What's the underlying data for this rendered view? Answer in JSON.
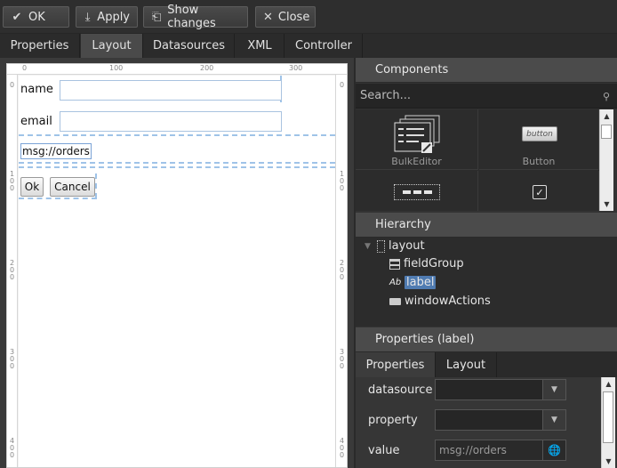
{
  "toolbar": {
    "ok_label": "OK",
    "apply_label": "Apply",
    "show_changes_label": "Show changes",
    "close_label": "Close"
  },
  "tabs": [
    {
      "label": "Properties"
    },
    {
      "label": "Layout"
    },
    {
      "label": "Datasources"
    },
    {
      "label": "XML"
    },
    {
      "label": "Controller"
    }
  ],
  "active_tab": "Layout",
  "canvas": {
    "ruler_top_ticks": [
      "0",
      "100",
      "200",
      "300"
    ],
    "ruler_left_ticks": [
      "0",
      "100",
      "200",
      "300",
      "400"
    ],
    "name_label": "name",
    "email_label": "email",
    "msg_label": "msg://orders",
    "ok_button": "Ok",
    "cancel_button": "Cancel"
  },
  "components": {
    "title": "Components",
    "search_placeholder": "Search...",
    "items": [
      {
        "name": "BulkEditor",
        "icon": "bulk-editor-icon"
      },
      {
        "name": "Button",
        "icon": "button-icon",
        "preview": "button"
      },
      {
        "name": "",
        "icon": "button-panel-icon"
      },
      {
        "name": "",
        "icon": "checkbox-icon"
      }
    ]
  },
  "hierarchy": {
    "title": "Hierarchy",
    "nodes": [
      {
        "label": "layout",
        "icon": "layout-icon"
      },
      {
        "label": "fieldGroup",
        "icon": "field-group-icon"
      },
      {
        "label": "label",
        "icon": "label-icon",
        "icon_text": "Ab",
        "selected": true
      },
      {
        "label": "windowActions",
        "icon": "window-actions-icon"
      }
    ]
  },
  "properties": {
    "title": "Properties (label)",
    "tabs": [
      {
        "label": "Properties"
      },
      {
        "label": "Layout"
      }
    ],
    "rows": {
      "datasource_label": "datasource",
      "datasource_value": "",
      "property_label": "property",
      "property_value": "",
      "value_label": "value",
      "value_value": "msg://orders"
    }
  },
  "colors": {
    "selection": "#4f7bb1",
    "dashed_outline": "#9fc3e8",
    "field_border": "#a9c3e0"
  }
}
